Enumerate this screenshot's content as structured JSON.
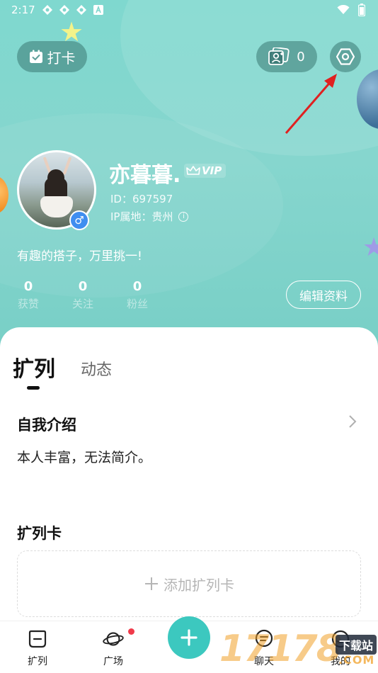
{
  "status_bar": {
    "time": "2:17"
  },
  "top_actions": {
    "checkin_label": "打卡",
    "visitor_count": "0"
  },
  "profile": {
    "name": "亦暮暮.",
    "vip_label": "VIP",
    "id_text": "ID：697597",
    "ip_text": "IP属地：贵州",
    "gender_symbol": "♂",
    "bio": "有趣的搭子，万里挑一!"
  },
  "stats": [
    {
      "value": "0",
      "label": "获赞"
    },
    {
      "value": "0",
      "label": "关注"
    },
    {
      "value": "0",
      "label": "粉丝"
    }
  ],
  "edit_label": "编辑资料",
  "tabs": {
    "active": "扩列",
    "inactive": "动态"
  },
  "sections": {
    "intro_title": "自我介绍",
    "intro_text": "本人丰富，无法简介。",
    "card_title": "扩列卡",
    "add_card_label": "添加扩列卡"
  },
  "bottom_nav": [
    {
      "label": "扩列"
    },
    {
      "label": "广场"
    },
    {
      "label": "聊天"
    },
    {
      "label": "我的"
    }
  ],
  "watermark": {
    "digits": "17178",
    "badge": "下载站",
    "suffix": ".COM"
  },
  "colors": {
    "header": "#80d6cd",
    "accent": "#3cc8bf",
    "arrow": "#e02020",
    "gender": "#3f8ef0"
  }
}
